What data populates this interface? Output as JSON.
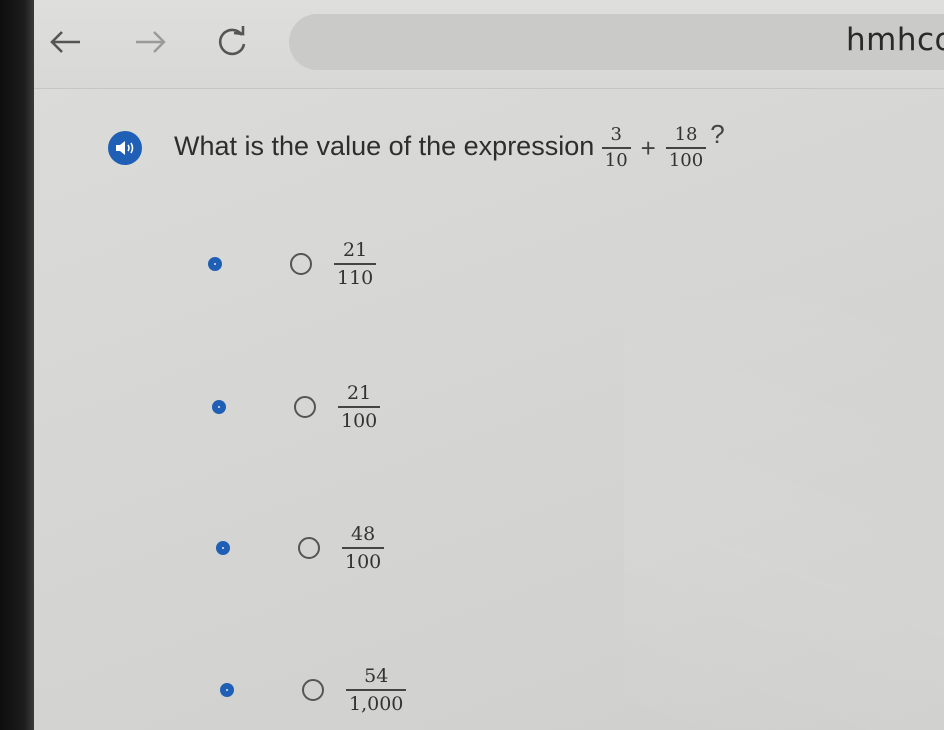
{
  "browser": {
    "url": "hmhco."
  },
  "question": {
    "prefix": "What is the value of the expression",
    "term1": {
      "num": "3",
      "den": "10"
    },
    "operator": "+",
    "term2": {
      "num": "18",
      "den": "100"
    },
    "suffix": "?"
  },
  "options": [
    {
      "num": "21",
      "den": "110"
    },
    {
      "num": "21",
      "den": "100"
    },
    {
      "num": "48",
      "den": "100"
    },
    {
      "num": "54",
      "den": "1,000"
    }
  ],
  "colors": {
    "accent": "#1f5fb5"
  },
  "icons": [
    "back-arrow-icon",
    "forward-arrow-icon",
    "reload-icon",
    "speaker-icon"
  ]
}
